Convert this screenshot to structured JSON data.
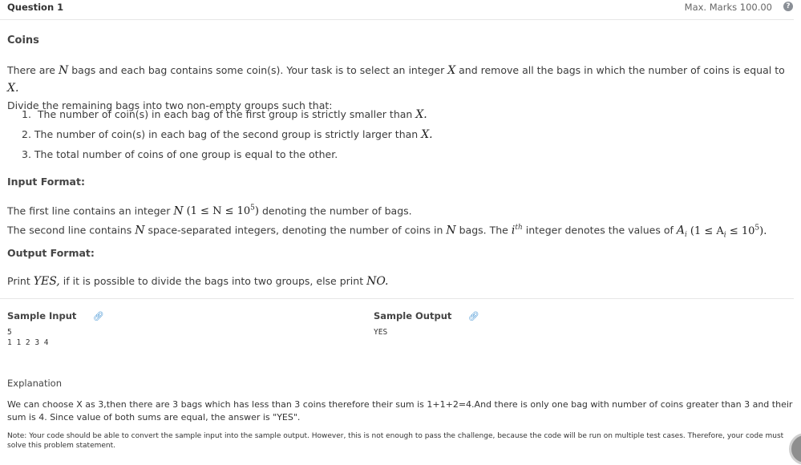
{
  "header": {
    "question": "Question 1",
    "max_marks": "Max. Marks 100.00",
    "help_icon": "question-circle-icon"
  },
  "problem": {
    "title": "Coins",
    "intro": {
      "p1": "There are",
      "N": "N",
      "p2": "bags and each bag contains some coin(s). Your task is to select an integer",
      "X": "X",
      "p3": "and remove all the bags in which the number of coins is equal to",
      "X2": "X.",
      "line2": "Divide the remaining bags into two non-empty groups such that:"
    },
    "conditions": [
      {
        "num": "1.",
        "text": "The number of coin(s) in each bag of the first group is strictly smaller than",
        "math": "X."
      },
      {
        "num": "2.",
        "text": "The number of coin(s) in each bag of the second group is strictly larger than",
        "math": "X."
      },
      {
        "num": "3.",
        "text": "The total number of coins of one group is equal to the other.",
        "math": ""
      }
    ],
    "input_format": {
      "heading": "Input Format:",
      "l1_a": "The first line contains an integer",
      "l1_N": "N",
      "l1_range": "(1 ≤ N ≤ 10",
      "l1_exp": "5",
      "l1_close": ")",
      "l1_b": "denoting the number of bags.",
      "l2_a": "The second line contains",
      "l2_N": "N",
      "l2_b": "space-separated integers, denoting the number of coins in",
      "l2_N2": "N",
      "l2_c": "bags. The",
      "l2_i": "i",
      "l2_th": "th",
      "l2_d": "integer denotes the values of",
      "l2_A": "A",
      "l2_sub": "i",
      "l2_range": "(1 ≤ A",
      "l2_range_sub": "i",
      "l2_range2": "≤ 10",
      "l2_exp": "5",
      "l2_close": ")."
    },
    "output_format": {
      "heading": "Output Format:",
      "a": "Print",
      "yes": "YES,",
      "b": "if it is possible to divide the bags into two groups, else print",
      "no": "NO."
    }
  },
  "samples": {
    "input_label": "Sample Input",
    "output_label": "Sample Output",
    "link_icon": "link-icon",
    "input_text": "5\n1 1 2 3 4",
    "output_text": "YES"
  },
  "explanation": {
    "heading": "Explanation",
    "text": "We can choose X as 3,then there are 3 bags which has less than 3 coins therefore their sum is 1+1+2=4.And there is only one bag with number of coins greater than 3 and their sum is 4. Since value of both sums are equal, the answer is \"YES\".",
    "note": "Note: Your code should be able to convert the sample input into the sample output. However, this is not enough to pass the challenge, because the code will be run on multiple test cases. Therefore, your code must solve this problem statement."
  }
}
